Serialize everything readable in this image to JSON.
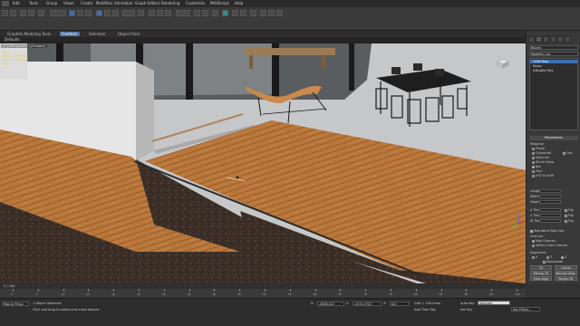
{
  "menu": [
    "Edit",
    "Tools",
    "Group",
    "Views",
    "Create",
    "Modifiers",
    "Animation",
    "Graph Editors",
    "Rendering",
    "Customize",
    "MAXScript",
    "Help"
  ],
  "ribbon": {
    "tabs": [
      "Graphite Modeling Tools",
      "Freeform",
      "Selection",
      "Object Paint"
    ],
    "active_tab": "Freeform",
    "sub_label": "Defaults"
  },
  "viewport": {
    "label": "[+] [Perspective] [Shaded]",
    "stats_title": "Total",
    "stats": [
      "Polys: 2,376,908",
      "Verts: 1,235,980",
      "FPS:"
    ]
  },
  "command_panel": {
    "name_field": "Blocks",
    "modifier_list": "Modifier List",
    "stack": [
      {
        "label": "UVW Map",
        "selected": true
      },
      {
        "label": "Noise",
        "selected": false
      },
      {
        "label": "Editable Poly",
        "selected": false
      }
    ],
    "rollout_title": "Parameters",
    "mapping_label": "Mapping:",
    "mapping_options": [
      {
        "label": "Planar",
        "on": false
      },
      {
        "label": "Cylindrical",
        "on": false
      },
      {
        "label": "Spherical",
        "on": false
      },
      {
        "label": "Shrink Wrap",
        "on": false
      },
      {
        "label": "Box",
        "on": true
      },
      {
        "label": "Face",
        "on": false
      },
      {
        "label": "XYZ to UVW",
        "on": false
      }
    ],
    "cap_label": "Cap",
    "spinners": [
      "Length:",
      "Width:",
      "Height:",
      "U Tile:",
      "V Tile:",
      "W Tile:"
    ],
    "flip_label": "Flip",
    "real_world": "Real-World Map Size",
    "channel_label": "Channel:",
    "map_channel": "Map Channel:",
    "vertex_color": "Vertex Color Channel",
    "alignment_label": "Alignment:",
    "axes": [
      "X",
      "Y",
      "Z"
    ],
    "manipulate": "Manipulate",
    "buttons": [
      "Fit",
      "Center",
      "Bitmap Fit",
      "Normal Align",
      "View Align",
      "Region Fit",
      "Reset",
      "Acquire"
    ]
  },
  "timeline": {
    "frame": "0 / 100",
    "ticks": [
      "0",
      "5",
      "10",
      "15",
      "20",
      "25",
      "30",
      "35",
      "40",
      "45",
      "50",
      "55",
      "60",
      "65",
      "70",
      "75",
      "80",
      "85",
      "90",
      "95",
      "100"
    ]
  },
  "status": {
    "maxscript": "Max to Physc",
    "selected": "1 Object Selected",
    "prompt": "Click and drag to select and move objects",
    "x_label": "X:",
    "x_value": "-2626.412",
    "y_label": "Y:",
    "y_value": "-2474.3715",
    "z_label": "Z:",
    "z_value": "0.0",
    "grid": "Grid = 100.0mm",
    "add_time_tag": "Add Time Tag",
    "auto_key": "Auto Key",
    "set_key": "Set Key",
    "selected_dropdown": "Selected",
    "key_filters": "Key Filters..."
  },
  "colors": {
    "accent": "#3d6fb0",
    "wood": "#b9773b",
    "soil": "#3b2e26"
  }
}
